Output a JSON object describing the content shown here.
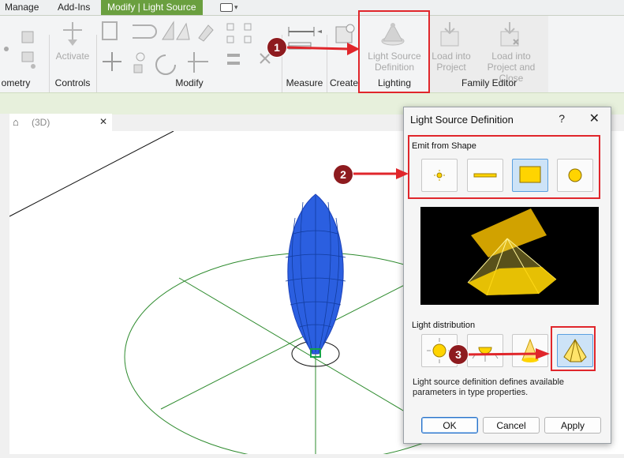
{
  "ribbon_tabs": [
    "Manage",
    "Add-Ins",
    "Modify | Light Source"
  ],
  "ribbon_panels": {
    "geometry": "ometry",
    "controls": "Controls",
    "modify": "Modify",
    "measure": "Measure",
    "create": "Create",
    "lighting": "Lighting",
    "family_editor": "Family Editor"
  },
  "ribbon_buttons": {
    "activate": "Activate",
    "light_source_definition": [
      "Light Source",
      "Definition"
    ],
    "load_into_project": [
      "Load into",
      "Project"
    ],
    "load_into_project_close": [
      "Load into",
      "Project and Close"
    ]
  },
  "view_tab": {
    "title": "(3D)",
    "close": "✕"
  },
  "dialog": {
    "title": "Light Source Definition",
    "help": "?",
    "close": "✕",
    "emit_label": "Emit from Shape",
    "emit_shapes": [
      "point",
      "line",
      "rectangle",
      "circle"
    ],
    "emit_selected": "rectangle",
    "distribution_label": "Light distribution",
    "distributions": [
      "spherical",
      "hemispherical",
      "spot",
      "photometric-web"
    ],
    "distribution_selected": "photometric-web",
    "description": "Light source definition defines available parameters in type properties.",
    "buttons": {
      "ok": "OK",
      "cancel": "Cancel",
      "apply": "Apply"
    }
  },
  "callouts": [
    "1",
    "2",
    "3"
  ],
  "colors": {
    "accent_green": "#6a9f3f",
    "callout_red": "#e0262b",
    "badge_red": "#8e1b1f",
    "wireframe_blue": "#1f4fd8",
    "grid_green": "#2e8b2e",
    "selection_blue": "#cde3f7",
    "light_yellow": "#ffd400"
  }
}
